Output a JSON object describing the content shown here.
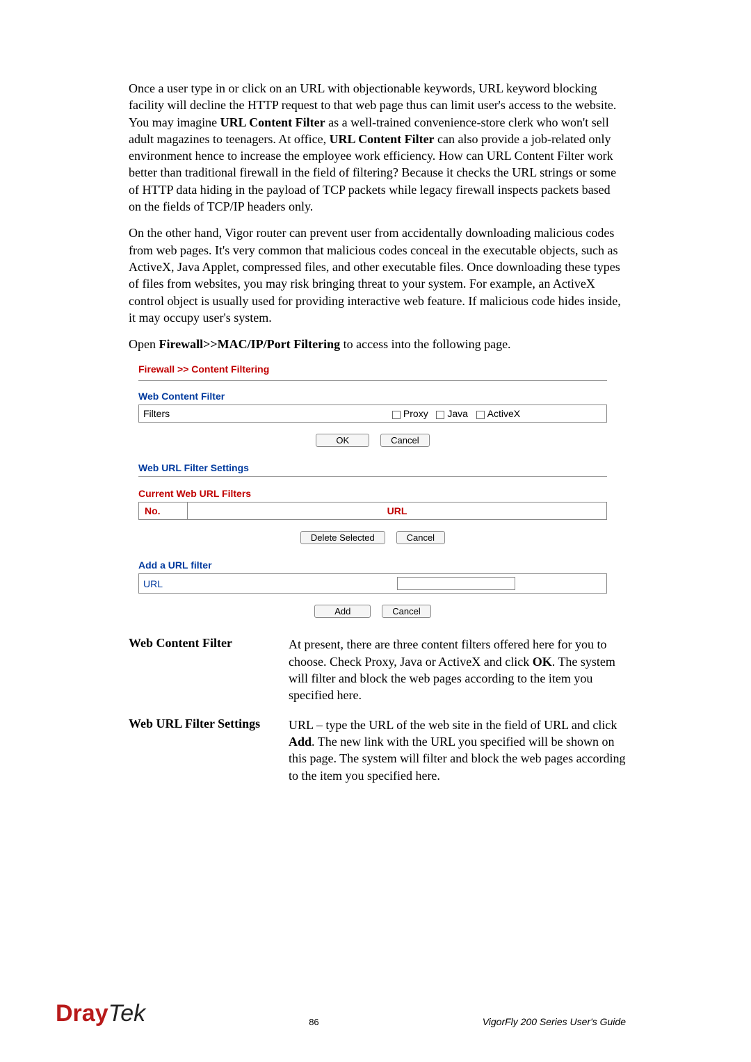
{
  "para": {
    "p1": "Once a user type in or click on an URL with objectionable keywords, URL keyword blocking facility will decline the HTTP request to that web page thus can limit user's access to the website. You may imagine ",
    "p1b1": "URL Content Filter",
    "p1m": " as a well-trained convenience-store clerk who won't sell adult magazines to teenagers. At office, ",
    "p1b2": "URL Content Filter",
    "p1e": " can also provide a job-related only environment hence to increase the employee work efficiency. How can URL Content Filter work better than traditional firewall in the field of filtering? Because it checks the URL strings or some of HTTP data hiding in the payload of TCP packets while legacy firewall inspects packets based on the fields of TCP/IP headers only.",
    "p2": "On the other hand, Vigor router can prevent user from accidentally downloading malicious codes from web pages. It's very common that malicious codes conceal in the executable objects, such as ActiveX, Java Applet, compressed files, and other executable files. Once downloading these types of files from websites, you may risk bringing threat to your system. For example, an ActiveX control object is usually used for providing interactive web feature. If malicious code hides inside, it may occupy user's system.",
    "p3a": "Open ",
    "p3b": "Firewall>>MAC/IP/Port Filtering",
    "p3c": " to access into the following page."
  },
  "form": {
    "breadcrumb": "Firewall >> Content Filtering",
    "wcf_head": "Web Content Filter",
    "filters_label": "Filters",
    "proxy": "Proxy",
    "java": "Java",
    "activex": "ActiveX",
    "ok": "OK",
    "cancel": "Cancel",
    "wufs_head": "Web URL Filter Settings",
    "cwuf_head": "Current Web URL Filters",
    "col_no": "No.",
    "col_url": "URL",
    "del_sel": "Delete Selected",
    "add_head": "Add a URL filter",
    "url_label": "URL",
    "add": "Add"
  },
  "desc": {
    "t1": "Web Content Filter",
    "d1a": "At present, there are three content filters offered here for you to choose. Check Proxy, Java or ActiveX and click ",
    "d1b": "OK",
    "d1c": ". The system will filter and block the web pages according to the item you specified here.",
    "t2": "Web URL Filter Settings",
    "d2a": "URL – type the URL of the web site in the field of URL and click ",
    "d2b": "Add",
    "d2c": ". The new link with the URL you specified will be shown on this page. The system will filter and block the web pages according to the item you specified here."
  },
  "footer": {
    "logo1": "Dray",
    "logo2": "Tek",
    "page": "86",
    "guide": "VigorFly 200 Series User's Guide"
  }
}
